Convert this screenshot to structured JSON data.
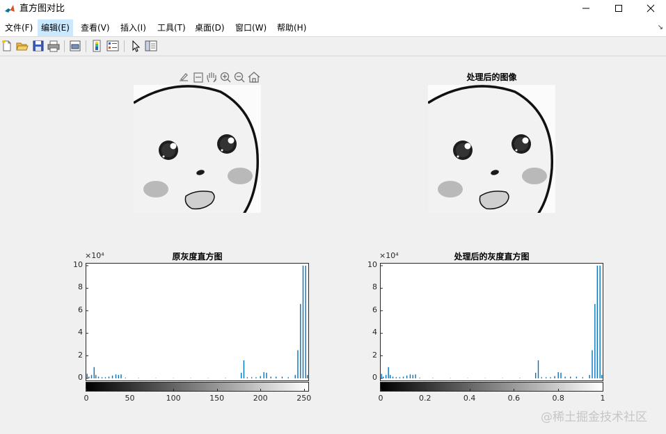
{
  "window": {
    "title": "直方图对比"
  },
  "menu": [
    {
      "label": "文件(F)"
    },
    {
      "label": "编辑(E)"
    },
    {
      "label": "查看(V)"
    },
    {
      "label": "插入(I)"
    },
    {
      "label": "工具(T)"
    },
    {
      "label": "桌面(D)"
    },
    {
      "label": "窗口(W)"
    },
    {
      "label": "帮助(H)"
    }
  ],
  "active_menu": "编辑(E)",
  "toolbar_icons": [
    "new-figure-icon",
    "open-file-icon",
    "save-icon",
    "print-icon",
    "print-preview-icon",
    "colorbar-icon",
    "legend-icon",
    "select-arrow-icon",
    "property-inspector-icon"
  ],
  "axes_toolbar_icons": [
    "brush-icon",
    "data-tip-icon",
    "pan-icon",
    "zoom-in-icon",
    "zoom-out-icon",
    "home-icon"
  ],
  "images": {
    "original_title": "",
    "processed_title": "处理后的图像"
  },
  "chart_data": [
    {
      "type": "bar",
      "title": "原灰度直方图",
      "xlabel": "",
      "ylabel": "",
      "y_exponent_label": "×10⁴",
      "xlim": [
        0,
        255
      ],
      "ylim": [
        0,
        10
      ],
      "xticks": [
        0,
        50,
        100,
        150,
        200,
        250
      ],
      "xtick_labels": [
        "0",
        "50",
        "100",
        "150",
        "200",
        "250"
      ],
      "yticks": [
        0,
        2,
        4,
        6,
        8,
        10
      ],
      "ytick_labels": [
        "0",
        "2",
        "4",
        "6",
        "8",
        "10"
      ],
      "colorbar": "gray, 0 (black) to 255 (white)",
      "bar_color": "#0072bd",
      "x": [
        1,
        3,
        6,
        9,
        11,
        14,
        18,
        22,
        26,
        30,
        34,
        37,
        40,
        45,
        60,
        80,
        100,
        120,
        140,
        160,
        178,
        181,
        185,
        190,
        195,
        200,
        204,
        207,
        212,
        218,
        225,
        232,
        240,
        243,
        246,
        249,
        252,
        254
      ],
      "values": [
        0.4,
        0.15,
        0.3,
        1.0,
        0.3,
        0.15,
        0.1,
        0.1,
        0.15,
        0.25,
        0.35,
        0.3,
        0.35,
        0.05,
        0.03,
        0.02,
        0.02,
        0.02,
        0.02,
        0.03,
        0.5,
        1.6,
        0.1,
        0.1,
        0.1,
        0.2,
        0.55,
        0.5,
        0.15,
        0.15,
        0.15,
        0.1,
        0.3,
        2.5,
        6.6,
        10.0,
        10.0,
        0.3
      ]
    },
    {
      "type": "bar",
      "title": "处理后的灰度直方图",
      "xlabel": "",
      "ylabel": "",
      "y_exponent_label": "×10⁴",
      "xlim": [
        0,
        1
      ],
      "ylim": [
        0,
        10
      ],
      "xticks": [
        0,
        0.2,
        0.4,
        0.6,
        0.8,
        1
      ],
      "xtick_labels": [
        "0",
        "0.2",
        "0.4",
        "0.6",
        "0.8",
        "1"
      ],
      "yticks": [
        0,
        2,
        4,
        6,
        8,
        10
      ],
      "ytick_labels": [
        "0",
        "2",
        "4",
        "6",
        "8",
        "10"
      ],
      "colorbar": "gray, 0 (black) to 1 (white)",
      "bar_color": "#0072bd",
      "x": [
        0.004,
        0.012,
        0.024,
        0.035,
        0.043,
        0.055,
        0.07,
        0.086,
        0.102,
        0.118,
        0.133,
        0.145,
        0.157,
        0.176,
        0.235,
        0.314,
        0.392,
        0.471,
        0.549,
        0.627,
        0.698,
        0.71,
        0.725,
        0.745,
        0.765,
        0.784,
        0.8,
        0.812,
        0.831,
        0.855,
        0.882,
        0.91,
        0.941,
        0.953,
        0.965,
        0.976,
        0.988,
        0.996
      ],
      "values": [
        0.4,
        0.15,
        0.3,
        1.0,
        0.3,
        0.15,
        0.1,
        0.1,
        0.15,
        0.25,
        0.35,
        0.3,
        0.35,
        0.05,
        0.03,
        0.02,
        0.02,
        0.02,
        0.02,
        0.03,
        0.5,
        1.6,
        0.1,
        0.1,
        0.1,
        0.2,
        0.55,
        0.5,
        0.15,
        0.15,
        0.15,
        0.1,
        0.3,
        2.5,
        6.6,
        10.0,
        10.0,
        0.3
      ]
    }
  ],
  "watermark": "@稀土掘金技术社区"
}
